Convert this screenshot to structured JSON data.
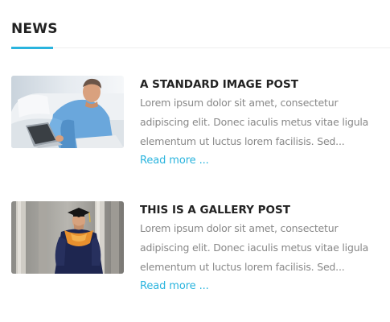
{
  "widget": {
    "title": "NEWS",
    "accent_color": "#2ab4de"
  },
  "posts": [
    {
      "title": "A STANDARD IMAGE POST",
      "excerpt_lines": [
        "Lorem ipsum dolor sit amet, consectetur",
        "adipiscing elit. Donec iaculis metus vitae ligula",
        "elementum ut luctus lorem facilisis. Sed..."
      ],
      "read_more": "Read more ...",
      "thumbnail_icon": "man-with-laptop-photo"
    },
    {
      "title": "THIS IS A GALLERY POST",
      "excerpt_lines": [
        "Lorem ipsum dolor sit amet, consectetur",
        "adipiscing elit. Donec iaculis metus vitae ligula",
        "elementum ut luctus lorem facilisis. Sed..."
      ],
      "read_more": "Read more ...",
      "thumbnail_icon": "graduate-photo"
    }
  ]
}
